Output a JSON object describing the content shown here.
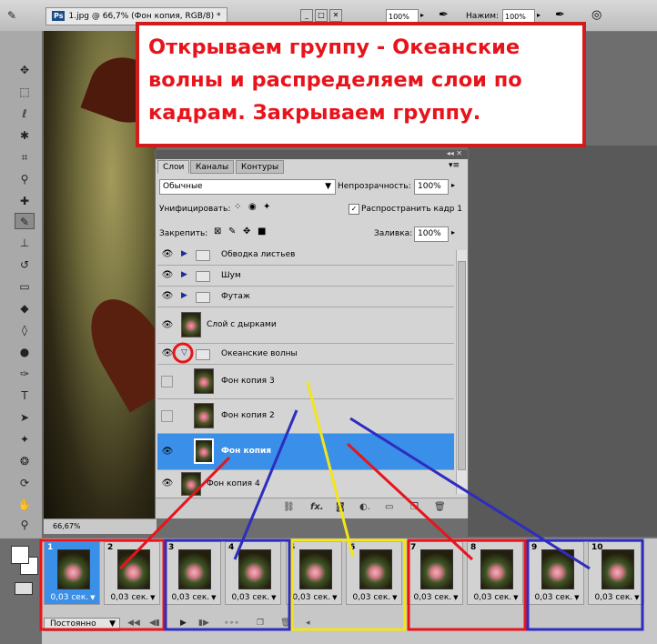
{
  "document_tab": "1.jpg @ 66,7% (Фон копия, RGB/8) *",
  "app_badge": "Ps",
  "topbar": {
    "zoom_left": "100%",
    "press_label": "Нажим:",
    "press_value": "100%"
  },
  "callout": {
    "text": "Открываем группу - Океанские волны и распределяем слои по кадрам. Закрываем группу."
  },
  "layers_panel": {
    "tabs": [
      "Слои",
      "Каналы",
      "Контуры"
    ],
    "blend_mode": "Обычные",
    "opacity_label": "Непрозрачность:",
    "opacity_value": "100%",
    "unify_label": "Унифицировать:",
    "propagate_label": "Распространить кадр 1",
    "lock_label": "Закрепить:",
    "fill_label": "Заливка:",
    "fill_value": "100%",
    "layers": [
      {
        "name": "Обводка листьев",
        "kind": "group"
      },
      {
        "name": "Шум",
        "kind": "group"
      },
      {
        "name": "Футаж",
        "kind": "group"
      },
      {
        "name": "Слой с дырками",
        "kind": "layer"
      },
      {
        "name": "Океанские волны",
        "kind": "group-open"
      },
      {
        "name": "Фон копия 3",
        "kind": "child"
      },
      {
        "name": "Фон копия 2",
        "kind": "child"
      },
      {
        "name": "Фон копия",
        "kind": "child-selected"
      },
      {
        "name": "Фон копия 4",
        "kind": "layer"
      }
    ]
  },
  "status_bar": {
    "zoom": "66,67%"
  },
  "timeline": {
    "frames": [
      {
        "num": "1",
        "delay": "0,03 сек."
      },
      {
        "num": "2",
        "delay": "0,03 сек."
      },
      {
        "num": "3",
        "delay": "0,03 сек."
      },
      {
        "num": "4",
        "delay": "0,03 сек."
      },
      {
        "num": "5",
        "delay": "0,03 сек."
      },
      {
        "num": "6",
        "delay": "0,03 сек."
      },
      {
        "num": "7",
        "delay": "0,03 сек."
      },
      {
        "num": "8",
        "delay": "0,03 сек."
      },
      {
        "num": "9",
        "delay": "0,03 сек."
      },
      {
        "num": "10",
        "delay": "0,03 сек."
      }
    ],
    "loop": "Постоянно"
  },
  "colors": {
    "highlight_red": "#e8141c",
    "highlight_blue": "#2d2dbf",
    "highlight_yellow": "#f2e51a",
    "selection_blue": "#3a8fe8"
  }
}
